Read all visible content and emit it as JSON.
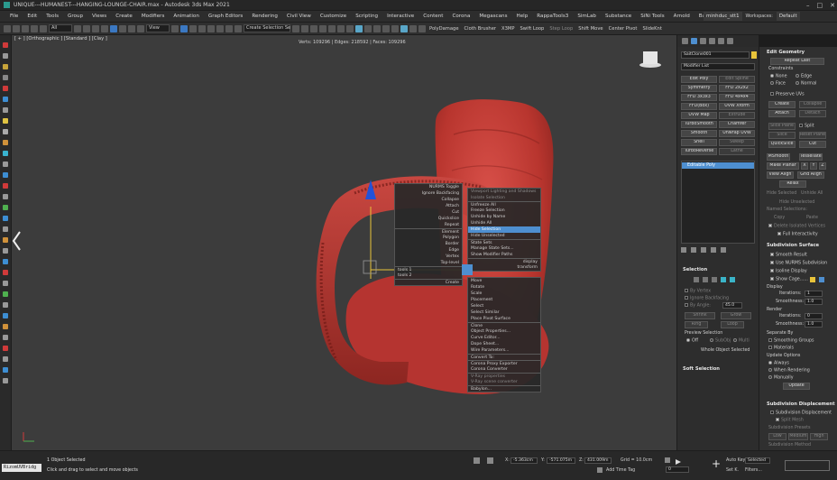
{
  "titlebar": {
    "title": "UNIQUE---HUMANEST---HANGING-LOUNGE-CHAIR.max - Autodesk 3ds Max 2021"
  },
  "menu": [
    "File",
    "Edit",
    "Tools",
    "Group",
    "Views",
    "Create",
    "Modifiers",
    "Animation",
    "Graph Editors",
    "Rendering",
    "Civil View",
    "Customize",
    "Scripting",
    "Interactive",
    "Content",
    "Corona",
    "Megascans",
    "Help",
    "RappaTools3",
    "SimLab",
    "Substance",
    "SiNi Tools",
    "Arnold",
    "Babylon"
  ],
  "user": {
    "name": "minhduc_stt1",
    "workspaces_label": "Workspaces:",
    "workspace": "Default"
  },
  "toolbar": {
    "all_filter": "All",
    "view_dropdown": "View",
    "selection_set": "Create Selection Se",
    "plugins": [
      "PolyDamage",
      "Cloth Brusher",
      "X3MP",
      "Swift Loop",
      "Step Loop",
      "Shift Move",
      "Center Pivot",
      "SlideKnt"
    ]
  },
  "viewport": {
    "label": "[ + ] [Orthographic ] [Standard ] [Clay ]",
    "stats": "Verts: 109296 | Edges: 218592 | Faces: 109296"
  },
  "quad_menu": {
    "top_left": [
      "NURMS Toggle",
      "Ignore Backfacing",
      "Collapse",
      "Attach",
      "Cut",
      "Quickslice",
      "Repeat",
      "Element",
      "Polygon",
      "Border",
      "Edge",
      "Vertex",
      "Top-level"
    ],
    "tools1": "tools 1",
    "tools2": "tools 2",
    "top_right": [
      "Viewport Lighting and Shadows",
      "Isolate Selection",
      "Unfreeze All",
      "Freeze Selection",
      "Unhide by Name",
      "Unhide All",
      "Hide Unselected",
      "Hide Selection",
      "State Sets",
      "Manage State Sets...",
      "Show Modifier Paths"
    ],
    "hide_selection": "Hide Selection",
    "display": "display",
    "transform": "transform",
    "create_label": "Create",
    "bottom_right": [
      "Move",
      "Rotate",
      "Scale",
      "Placement",
      "Select",
      "Select Similar",
      "Place Pivot Surface",
      "Clone",
      "Object Properties...",
      "Curve Editor...",
      "Dope Sheet...",
      "Wire Parameters...",
      "Convert To:",
      "Corona Proxy Exporter",
      "Corona Converter",
      "V-Ray properties",
      "V-Ray scene converter",
      "Babylon..."
    ]
  },
  "command_panel": {
    "object_name": "SaitClone001",
    "modifier_list": "Modifier List",
    "modifier_buttons": [
      [
        "Edit Poly",
        "Edit Spline"
      ],
      [
        "Symmetry",
        "FFD 2x2x2"
      ],
      [
        "FFD 3x3x3",
        "FFD 4x4x4"
      ],
      [
        "FFD(Box)",
        "UVW Xform"
      ],
      [
        "UVW Map",
        "Extrude"
      ],
      [
        "TurboSmooth",
        "Chamfer"
      ],
      [
        "Smooth",
        "Unwrap UVW"
      ],
      [
        "Shell",
        "Sweep"
      ],
      [
        "TurboReverse",
        "Lathe"
      ]
    ],
    "stack_item": "Editable Poly",
    "selection_header": "Selection",
    "by_vertex": "By Vertex",
    "ignore_backfacing": "Ignore Backfacing",
    "by_angle": "By Angle:",
    "by_angle_value": "45.0",
    "shrink": "Shrink",
    "grow": "Grow",
    "ring": "Ring",
    "loop": "Loop",
    "preview_selection": "Preview Selection",
    "off": "Off",
    "subobj": "SubObj",
    "multi": "Multi",
    "whole_object": "Whole Object Selected",
    "soft_selection": "Soft Selection"
  },
  "edit_geometry": {
    "header": "Edit Geometry",
    "repeat_last": "Repeat Last",
    "constraints": "Constraints",
    "c_none": "None",
    "c_edge": "Edge",
    "c_face": "Face",
    "c_normal": "Normal",
    "preserve_uvs": "Preserve UVs",
    "create": "Create",
    "collapse": "Collapse",
    "attach": "Attach",
    "detach": "Detach",
    "slice_plane": "Slice Plane",
    "split": "Split",
    "slice": "Slice",
    "reset_plane": "Reset Plane",
    "quickslice": "QuickSlice",
    "cut": "Cut",
    "msmooth": "MSmooth",
    "tessellate": "Tessellate",
    "make_planar": "Make Planar",
    "x": "X",
    "y": "Y",
    "z": "Z",
    "view_align": "View Align",
    "grid_align": "Grid Align",
    "relax": "Relax",
    "hide_selected": "Hide Selected",
    "unhide_all": "Unhide All",
    "hide_unselected": "Hide Unselected",
    "named_selections": "Named Selections:",
    "copy": "Copy",
    "paste": "Paste",
    "delete_isolated": "Delete Isolated Vertices",
    "full_interactivity": "Full Interactivity"
  },
  "subdivision_surface": {
    "header": "Subdivision Surface",
    "smooth_result": "Smooth Result",
    "use_nurms": "Use NURMS Subdivision",
    "isoline": "Isoline Display",
    "show_cage": "Show Cage......",
    "display": "Display",
    "iterations_label": "Iterations:",
    "iterations": "1",
    "smoothness_label": "Smoothness:",
    "smoothness": "1.0",
    "render": "Render",
    "r_iterations": "0",
    "r_smoothness": "1.0",
    "separate_by": "Separate By",
    "smoothing_groups": "Smoothing Groups",
    "materials": "Materials",
    "update_options": "Update Options",
    "always": "Always",
    "when_rendering": "When Rendering",
    "manually": "Manually",
    "update": "Update"
  },
  "subdivision_displacement": {
    "header": "Subdivision Displacement",
    "subdivision_displacement": "Subdivision Displacement",
    "split_mesh": "Split Mesh",
    "presets_label": "Subdivision Presets",
    "low": "Low",
    "medium": "Medium",
    "high": "High",
    "method": "Subdivision Method"
  },
  "status": {
    "maxscript": "RizomUVBridg",
    "selected": "1 Object Selected",
    "hint": "Click and drag to select and move objects",
    "x_label": "X:",
    "x": "-5.363cm",
    "y_label": "Y:",
    "y": "-571.075m",
    "z_label": "Z:",
    "z": "431.009m",
    "grid": "Grid = 10.0cm",
    "add_time_tag": "Add Time Tag",
    "autokey": "Auto Key",
    "selected_dd": "Selected",
    "setkey": "Set K.",
    "filters": "Filters...",
    "frame": "0"
  },
  "colors": {
    "accent": "#4e8fd0",
    "chair": "#b8352e",
    "viewport": "#3c3c3c",
    "highlight_yellow": "#e8c33a"
  }
}
